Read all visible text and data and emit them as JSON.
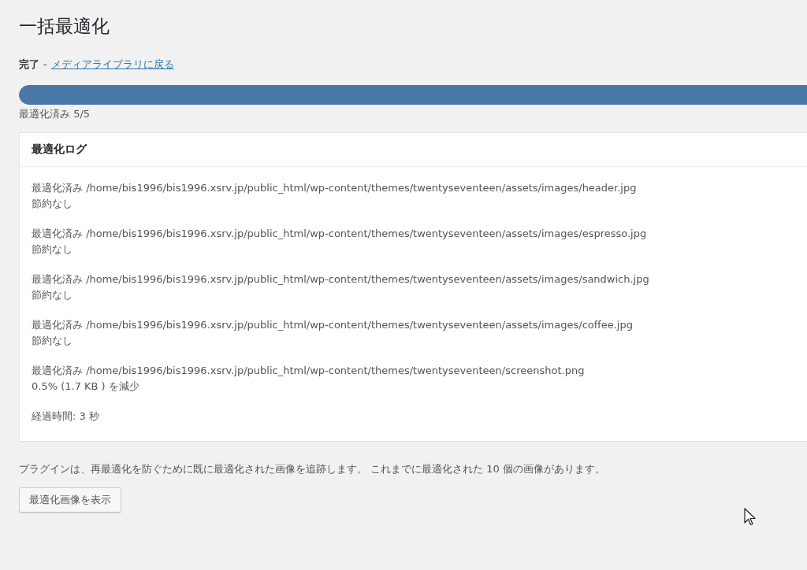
{
  "title": "一括最適化",
  "status": {
    "label": "完了",
    "separator": "-",
    "link": "メディアライブラリに戻る"
  },
  "progress": {
    "level": 1,
    "caption": "最適化済み 5/5"
  },
  "log": {
    "heading": "最適化ログ",
    "entries": [
      {
        "file": "最適化済み /home/bis1996/bis1996.xsrv.jp/public_html/wp-content/themes/twentyseventeen/assets/images/header.jpg",
        "result": "節約なし"
      },
      {
        "file": "最適化済み /home/bis1996/bis1996.xsrv.jp/public_html/wp-content/themes/twentyseventeen/assets/images/espresso.jpg",
        "result": "節約なし"
      },
      {
        "file": "最適化済み /home/bis1996/bis1996.xsrv.jp/public_html/wp-content/themes/twentyseventeen/assets/images/sandwich.jpg",
        "result": "節約なし"
      },
      {
        "file": "最適化済み /home/bis1996/bis1996.xsrv.jp/public_html/wp-content/themes/twentyseventeen/assets/images/coffee.jpg",
        "result": "節約なし"
      },
      {
        "file": "最適化済み /home/bis1996/bis1996.xsrv.jp/public_html/wp-content/themes/twentyseventeen/screenshot.png",
        "result": "0.5% (1.7 KB ) を減少"
      }
    ],
    "elapsed": "経過時間: 3 秒"
  },
  "note": "プラグインは、再最適化を防ぐために既に最適化された画像を追跡します。 これまでに最適化された 10 個の画像があります。",
  "button": "最適化画像を表示"
}
